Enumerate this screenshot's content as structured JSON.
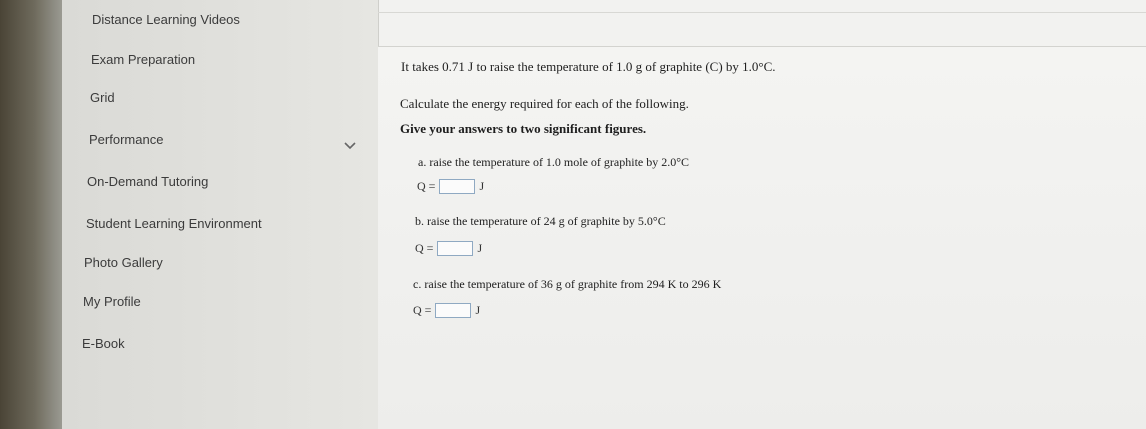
{
  "sidebar": {
    "items": [
      {
        "label": "Distance Learning Videos"
      },
      {
        "label": "Exam Preparation"
      },
      {
        "label": "Grid"
      },
      {
        "label": "Performance"
      },
      {
        "label": "On-Demand Tutoring"
      },
      {
        "label": "Student Learning Environment"
      },
      {
        "label": "Photo Gallery"
      },
      {
        "label": "My Profile"
      },
      {
        "label": "E-Book"
      }
    ],
    "chevron_icon": "chevron-down-icon"
  },
  "question": {
    "intro": "It takes 0.71 J to raise the temperature of 1.0 g of graphite (C) by 1.0°C.",
    "instruction": "Calculate the energy required for each of the following.",
    "sig_figs": "Give your answers to two significant figures.",
    "parts": [
      {
        "text": "a. raise the temperature of 1.0 mole of graphite by 2.0°C",
        "q_label": "Q =",
        "unit": "J",
        "value": ""
      },
      {
        "text": "b. raise the temperature of 24 g of graphite by 5.0°C",
        "q_label": "Q =",
        "unit": "J",
        "value": ""
      },
      {
        "text": "c. raise the temperature of 36 g of graphite from 294 K to 296 K",
        "q_label": "Q =",
        "unit": "J",
        "value": ""
      }
    ]
  },
  "colors": {
    "answer_box_border": "#8fa9c2"
  }
}
